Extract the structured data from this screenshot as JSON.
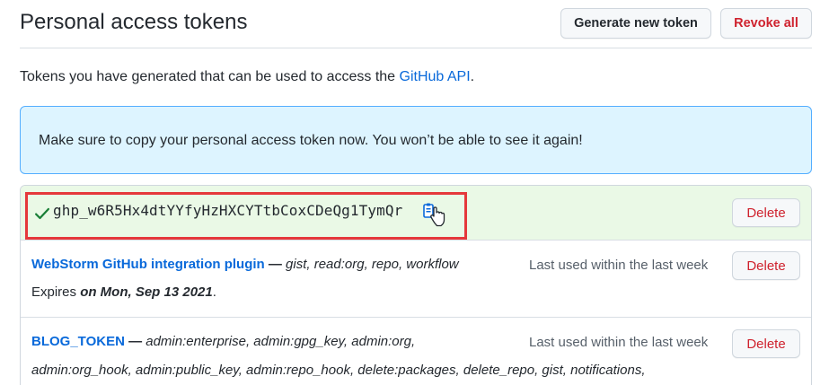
{
  "header": {
    "title": "Personal access tokens",
    "generate_label": "Generate new token",
    "revoke_label": "Revoke all"
  },
  "intro": {
    "text": "Tokens you have generated that can be used to access the ",
    "link": "GitHub API",
    "end": "."
  },
  "flash": {
    "message": "Make sure to copy your personal access token now. You won’t be able to see it again!"
  },
  "new_token": {
    "value": "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",
    "delete_label": "Delete"
  },
  "tokens": [
    {
      "name": "WebStorm GitHub integration plugin",
      "separator": " — ",
      "scopes": "gist, read:org, repo, workflow",
      "last_used": "Last used within the last week",
      "expires_prefix": "Expires ",
      "expires_date": "on Mon, Sep 13 2021",
      "expires_suffix": ".",
      "delete_label": "Delete"
    },
    {
      "name": "BLOG_TOKEN",
      "separator": " — ",
      "scopes": "admin:enterprise, admin:gpg_key, admin:org,",
      "scopes_line2": "admin:org_hook, admin:public_key, admin:repo_hook, delete:packages, delete_repo, gist, notifications,",
      "last_used": "Last used within the last week",
      "delete_label": "Delete"
    }
  ],
  "colors": {
    "link": "#0969da",
    "danger": "#cf222e",
    "flash_bg": "#ddf4ff",
    "new_token_bg": "#eaf9e6",
    "highlight_border": "#e5383b"
  }
}
